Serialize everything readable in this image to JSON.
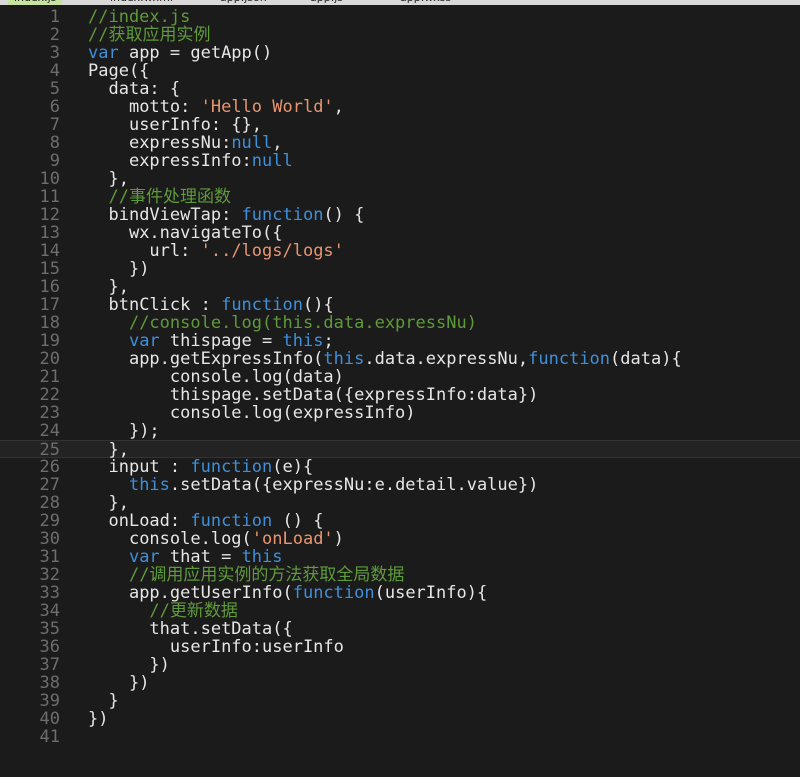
{
  "tabs": [
    {
      "label": "index.js",
      "active": true
    },
    {
      "label": "index.wxml"
    },
    {
      "label": "app.json"
    },
    {
      "label": "app.js"
    },
    {
      "label": "app.wxss"
    }
  ],
  "colors": {
    "background": "#1b1b1b",
    "comment": "#5f9a3a",
    "keyword": "#3f8fd9",
    "string": "#e9956f",
    "plain": "#e6e6e6",
    "line_number": "#6d6d6d"
  },
  "current_line": 25,
  "lines": [
    {
      "n": "1",
      "indent": "",
      "tokens": [
        [
          "cm",
          "//index.js"
        ]
      ]
    },
    {
      "n": "2",
      "indent": "",
      "tokens": [
        [
          "cm",
          "//获取应用实例"
        ]
      ]
    },
    {
      "n": "3",
      "indent": "",
      "tokens": [
        [
          "kw",
          "var"
        ],
        [
          "pl",
          " app = getApp()"
        ]
      ]
    },
    {
      "n": "4",
      "indent": "",
      "tokens": [
        [
          "pl",
          "Page({"
        ]
      ]
    },
    {
      "n": "5",
      "indent": "  ",
      "tokens": [
        [
          "pl",
          "data: {"
        ]
      ]
    },
    {
      "n": "6",
      "indent": "    ",
      "tokens": [
        [
          "pl",
          "motto: "
        ],
        [
          "st",
          "'Hello World'"
        ],
        [
          "pl",
          ","
        ]
      ]
    },
    {
      "n": "7",
      "indent": "    ",
      "tokens": [
        [
          "pl",
          "userInfo: {},"
        ]
      ]
    },
    {
      "n": "8",
      "indent": "    ",
      "tokens": [
        [
          "pl",
          "expressNu:"
        ],
        [
          "kw",
          "null"
        ],
        [
          "pl",
          ","
        ]
      ]
    },
    {
      "n": "9",
      "indent": "    ",
      "tokens": [
        [
          "pl",
          "expressInfo:"
        ],
        [
          "kw",
          "null"
        ]
      ]
    },
    {
      "n": "10",
      "indent": "  ",
      "tokens": [
        [
          "pl",
          "},"
        ]
      ]
    },
    {
      "n": "11",
      "indent": "  ",
      "tokens": [
        [
          "cm",
          "//事件处理函数"
        ]
      ]
    },
    {
      "n": "12",
      "indent": "  ",
      "tokens": [
        [
          "pl",
          "bindViewTap: "
        ],
        [
          "kw",
          "function"
        ],
        [
          "pl",
          "() {"
        ]
      ]
    },
    {
      "n": "13",
      "indent": "    ",
      "tokens": [
        [
          "pl",
          "wx.navigateTo({"
        ]
      ]
    },
    {
      "n": "14",
      "indent": "      ",
      "tokens": [
        [
          "pl",
          "url: "
        ],
        [
          "st",
          "'../logs/logs'"
        ]
      ]
    },
    {
      "n": "15",
      "indent": "    ",
      "tokens": [
        [
          "pl",
          "})"
        ]
      ]
    },
    {
      "n": "16",
      "indent": "  ",
      "tokens": [
        [
          "pl",
          "},"
        ]
      ]
    },
    {
      "n": "17",
      "indent": "  ",
      "tokens": [
        [
          "pl",
          "btnClick : "
        ],
        [
          "kw",
          "function"
        ],
        [
          "pl",
          "(){"
        ]
      ]
    },
    {
      "n": "18",
      "indent": "    ",
      "tokens": [
        [
          "cm",
          "//console.log(this.data.expressNu)"
        ]
      ]
    },
    {
      "n": "19",
      "indent": "    ",
      "tokens": [
        [
          "kw",
          "var"
        ],
        [
          "pl",
          " thispage = "
        ],
        [
          "kw",
          "this"
        ],
        [
          "pl",
          ";"
        ]
      ]
    },
    {
      "n": "20",
      "indent": "    ",
      "tokens": [
        [
          "pl",
          "app.getExpressInfo("
        ],
        [
          "kw",
          "this"
        ],
        [
          "pl",
          ".data.expressNu,"
        ],
        [
          "kw",
          "function"
        ],
        [
          "pl",
          "(data){"
        ]
      ]
    },
    {
      "n": "21",
      "indent": "        ",
      "tokens": [
        [
          "pl",
          "console.log(data)"
        ]
      ]
    },
    {
      "n": "22",
      "indent": "        ",
      "tokens": [
        [
          "pl",
          "thispage.setData({expressInfo:data})"
        ]
      ]
    },
    {
      "n": "23",
      "indent": "        ",
      "tokens": [
        [
          "pl",
          "console.log(expressInfo)"
        ]
      ]
    },
    {
      "n": "24",
      "indent": "    ",
      "tokens": [
        [
          "pl",
          "});"
        ]
      ]
    },
    {
      "n": "25",
      "indent": "  ",
      "tokens": [
        [
          "pl",
          "},"
        ]
      ]
    },
    {
      "n": "26",
      "indent": "  ",
      "tokens": [
        [
          "pl",
          "input : "
        ],
        [
          "kw",
          "function"
        ],
        [
          "pl",
          "(e){"
        ]
      ]
    },
    {
      "n": "27",
      "indent": "    ",
      "tokens": [
        [
          "kw",
          "this"
        ],
        [
          "pl",
          ".setData({expressNu:e.detail.value})"
        ]
      ]
    },
    {
      "n": "28",
      "indent": "  ",
      "tokens": [
        [
          "pl",
          "},"
        ]
      ]
    },
    {
      "n": "29",
      "indent": "  ",
      "tokens": [
        [
          "pl",
          "onLoad: "
        ],
        [
          "kw",
          "function"
        ],
        [
          "pl",
          " () {"
        ]
      ]
    },
    {
      "n": "30",
      "indent": "    ",
      "tokens": [
        [
          "pl",
          "console.log("
        ],
        [
          "st",
          "'onLoad'"
        ],
        [
          "pl",
          ")"
        ]
      ]
    },
    {
      "n": "31",
      "indent": "    ",
      "tokens": [
        [
          "kw",
          "var"
        ],
        [
          "pl",
          " that = "
        ],
        [
          "kw",
          "this"
        ]
      ]
    },
    {
      "n": "32",
      "indent": "    ",
      "tokens": [
        [
          "cm",
          "//调用应用实例的方法获取全局数据"
        ]
      ]
    },
    {
      "n": "33",
      "indent": "    ",
      "tokens": [
        [
          "pl",
          "app.getUserInfo("
        ],
        [
          "kw",
          "function"
        ],
        [
          "pl",
          "(userInfo){"
        ]
      ]
    },
    {
      "n": "34",
      "indent": "      ",
      "tokens": [
        [
          "cm",
          "//更新数据"
        ]
      ]
    },
    {
      "n": "35",
      "indent": "      ",
      "tokens": [
        [
          "pl",
          "that.setData({"
        ]
      ]
    },
    {
      "n": "36",
      "indent": "        ",
      "tokens": [
        [
          "pl",
          "userInfo:userInfo"
        ]
      ]
    },
    {
      "n": "37",
      "indent": "      ",
      "tokens": [
        [
          "pl",
          "})"
        ]
      ]
    },
    {
      "n": "38",
      "indent": "    ",
      "tokens": [
        [
          "pl",
          "})"
        ]
      ]
    },
    {
      "n": "39",
      "indent": "  ",
      "tokens": [
        [
          "pl",
          "}"
        ]
      ]
    },
    {
      "n": "40",
      "indent": "",
      "tokens": [
        [
          "pl",
          "})"
        ]
      ]
    },
    {
      "n": "41",
      "indent": "",
      "tokens": []
    }
  ]
}
